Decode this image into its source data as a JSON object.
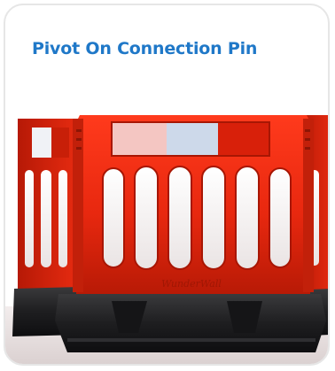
{
  "card": {
    "title": "Pivot On Connection Pin",
    "accent_color": "#1f78c8"
  },
  "image": {
    "subject": "barrier-photo",
    "embossed_text": "WunderWall"
  }
}
